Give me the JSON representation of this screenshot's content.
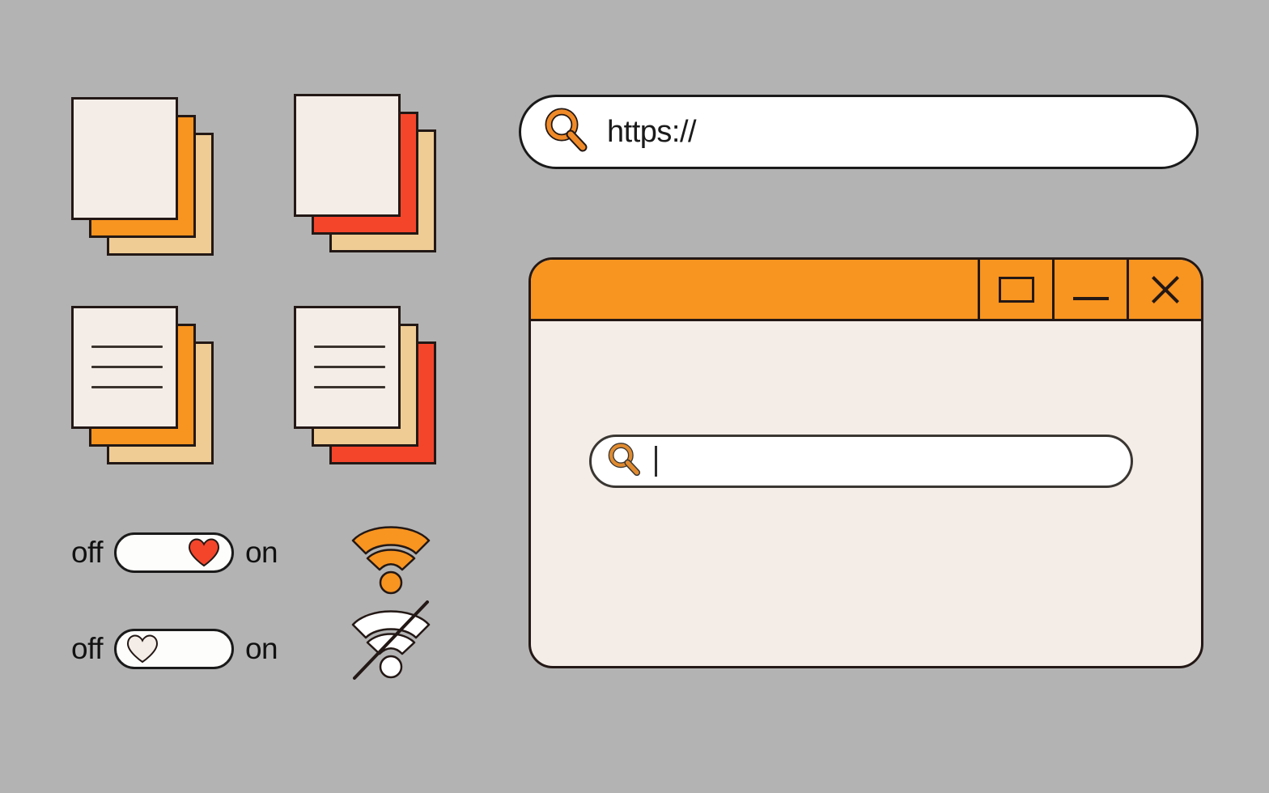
{
  "theme": {
    "background": "#b3b3b3",
    "orange": "#f89420",
    "tan": "#efcc94",
    "red": "#f4452b",
    "cream": "#f4ece7",
    "outline": "#231815",
    "white": "#ffffff"
  },
  "paper_stacks": [
    {
      "name": "blank-stack-orange",
      "has_lines": false,
      "layers": [
        "cream",
        "orange",
        "tan"
      ]
    },
    {
      "name": "blank-stack-red",
      "has_lines": false,
      "layers": [
        "cream",
        "red",
        "tan"
      ]
    },
    {
      "name": "lined-stack-orange",
      "has_lines": true,
      "layers": [
        "cream",
        "orange",
        "tan"
      ]
    },
    {
      "name": "lined-stack-red",
      "has_lines": true,
      "layers": [
        "cream",
        "tan",
        "red"
      ]
    }
  ],
  "toggles": [
    {
      "off_label": "off",
      "on_label": "on",
      "state": "on",
      "knob": "heart",
      "knob_color": "#f4452b"
    },
    {
      "off_label": "off",
      "on_label": "on",
      "state": "off",
      "knob": "heart",
      "knob_color": "#f4ece7"
    }
  ],
  "wifi_icons": [
    {
      "name": "wifi-on-icon",
      "state": "on",
      "color": "#f89420"
    },
    {
      "name": "wifi-off-icon",
      "state": "off",
      "color": "#ffffff"
    }
  ],
  "url_bar": {
    "icon": "search-icon",
    "value": "https://",
    "placeholder": "https://"
  },
  "browser_window": {
    "title": "",
    "controls": [
      {
        "name": "maximize-button",
        "glyph": "square"
      },
      {
        "name": "minimize-button",
        "glyph": "dash"
      },
      {
        "name": "close-button",
        "glyph": "cross"
      }
    ],
    "search": {
      "icon": "search-icon",
      "value": "",
      "placeholder": "",
      "caret_visible": true
    }
  }
}
